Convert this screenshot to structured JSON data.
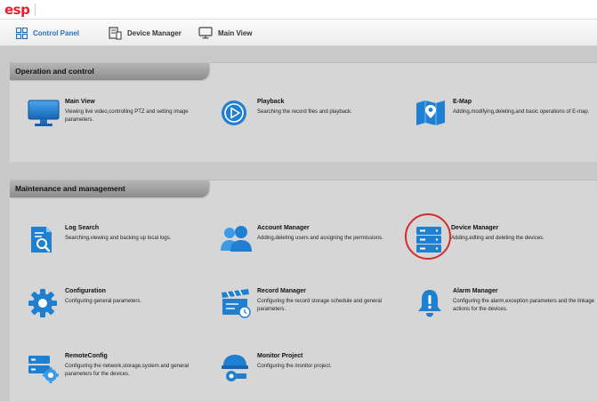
{
  "app": {
    "logo_text": "esp"
  },
  "toolbar": {
    "items": [
      {
        "label": "Control Panel",
        "icon": "grid-icon"
      },
      {
        "label": "Device Manager",
        "icon": "server-icon"
      },
      {
        "label": "Main View",
        "icon": "monitor-icon"
      }
    ]
  },
  "sections": [
    {
      "title": "Operation and control",
      "modules": [
        {
          "title": "Main View",
          "desc": "Viewing live video,controlling PTZ and setting image parameters.",
          "icon": "monitor-icon"
        },
        {
          "title": "Playback",
          "desc": "Searching the record files and playback.",
          "icon": "play-circle-icon"
        },
        {
          "title": "E-Map",
          "desc": "Adding,modifying,deleting,and basic operations of E-map.",
          "icon": "map-pin-icon"
        }
      ]
    },
    {
      "title": "Maintenance and management",
      "modules": [
        {
          "title": "Log Search",
          "desc": "Searching,viewing and backing up local logs.",
          "icon": "log-search-icon"
        },
        {
          "title": "Account Manager",
          "desc": "Adding,deleting users and assigning the permissions.",
          "icon": "users-icon"
        },
        {
          "title": "Device Manager",
          "desc": "Adding,edting and deleting the devices.",
          "icon": "device-manager-icon"
        },
        {
          "title": "Configuration",
          "desc": "Configuring general parameters.",
          "icon": "gear-icon"
        },
        {
          "title": "Record Manager",
          "desc": "Configuring the record storage schedule and general parameters.",
          "icon": "clapperboard-icon"
        },
        {
          "title": "Alarm Manager",
          "desc": "Configuring the alarm,exception parameters and the linkage actions for the devices.",
          "icon": "bell-icon"
        },
        {
          "title": "RemoteConfig",
          "desc": "Configuring the network,storage,system and general parameters for the devices.",
          "icon": "remote-config-icon"
        },
        {
          "title": "Monitor Project",
          "desc": "Configuring the monitor project.",
          "icon": "camera-icon"
        }
      ]
    }
  ],
  "colors": {
    "accent": "#2a6fbd",
    "icon_blue": "#1f7fd0",
    "highlight": "#d52b2b",
    "panel_bg": "#d6d6d6"
  }
}
